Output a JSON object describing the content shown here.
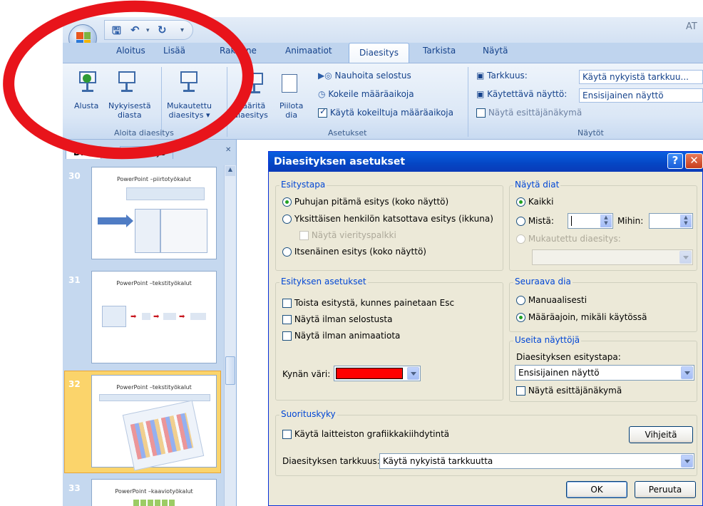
{
  "ribbon": {
    "title_fragment": "AT",
    "tabs": [
      "Aloitus",
      "Lisää",
      "Rakenne",
      "Animaatiot",
      "Diaesitys",
      "Tarkista",
      "Näytä"
    ],
    "groups": {
      "start": {
        "label": "Aloita diaesitys",
        "alusta": "Alusta",
        "nykyisesta_1": "Nykyisestä",
        "nykyisesta_2": "diasta",
        "mukautettu_1": "Mukautettu",
        "mukautettu_2": "diaesitys"
      },
      "setup": {
        "label": "Asetukset",
        "maarita_1": "Määritä",
        "maarita_2": "diaesitys",
        "piilota_1": "Piilota",
        "piilota_2": "dia",
        "nauhoita": "Nauhoita selostus",
        "kokeile": "Kokeile määräaikoja",
        "kayta": "Käytä kokeiltuja määräaikoja"
      },
      "monitors": {
        "label": "Näytöt",
        "tarkkuus_label": "Tarkkuus:",
        "tarkkuus_value": "Käytä nykyistä tarkkuu...",
        "naytto_label": "Käytettävä näyttö:",
        "naytto_value": "Ensisijainen näyttö",
        "esittaja": "Näytä esittäjänäkymä"
      }
    }
  },
  "panel": {
    "tab_diat": "Diat",
    "tab_jasennys": "Jäsennys",
    "slides": [
      {
        "num": "30",
        "title": "PowerPoint –piirtotyökalut"
      },
      {
        "num": "31",
        "title": "PowerPoint –tekstityökalut"
      },
      {
        "num": "32",
        "title": "PowerPoint –tekstityökalut"
      },
      {
        "num": "33",
        "title": "PowerPoint –kaaviotyökalut"
      }
    ]
  },
  "dialog": {
    "title": "Diaesityksen asetukset",
    "help": "?",
    "esitystapa": {
      "legend": "Esitystapa",
      "opt1": "Puhujan pitämä esitys (koko näyttö)",
      "opt2": "Yksittäisen henkilön katsottava esitys (ikkuna)",
      "scroll": "Näytä vierityspalkki",
      "opt3": "Itsenäinen esitys (koko näyttö)"
    },
    "nayta_diat": {
      "legend": "Näytä diat",
      "kaikki": "Kaikki",
      "mista": "Mistä:",
      "mihin": "Mihin:",
      "mukautettu": "Mukautettu diaesitys:"
    },
    "esityksen_asetukset": {
      "legend": "Esityksen asetukset",
      "toista": "Toista esitystä, kunnes painetaan Esc",
      "ilman_selostusta": "Näytä ilman selostusta",
      "ilman_animaatiota": "Näytä ilman animaatiota",
      "kynan_vari": "Kynän väri:",
      "pen_color": "#ff0000"
    },
    "seuraava_dia": {
      "legend": "Seuraava dia",
      "manuaalisesti": "Manuaalisesti",
      "maaraajoin": "Määräajoin, mikäli käytössä"
    },
    "useita_nayttoja": {
      "legend": "Useita näyttöjä",
      "esitystapa_label": "Diaesityksen esitystapa:",
      "naytto_value": "Ensisijainen näyttö",
      "esittaja": "Näytä esittäjänäkymä"
    },
    "suorituskyky": {
      "legend": "Suorituskyky",
      "laitteisto": "Käytä laitteiston grafiikkakiihdytintä",
      "vihjeita": "Vihjeitä",
      "tarkkuus_label": "Diaesityksen tarkkuus:",
      "tarkkuus_value": "Käytä nykyistä tarkkuutta"
    },
    "ok": "OK",
    "cancel": "Peruuta"
  },
  "annotation_color": "#e8141b"
}
